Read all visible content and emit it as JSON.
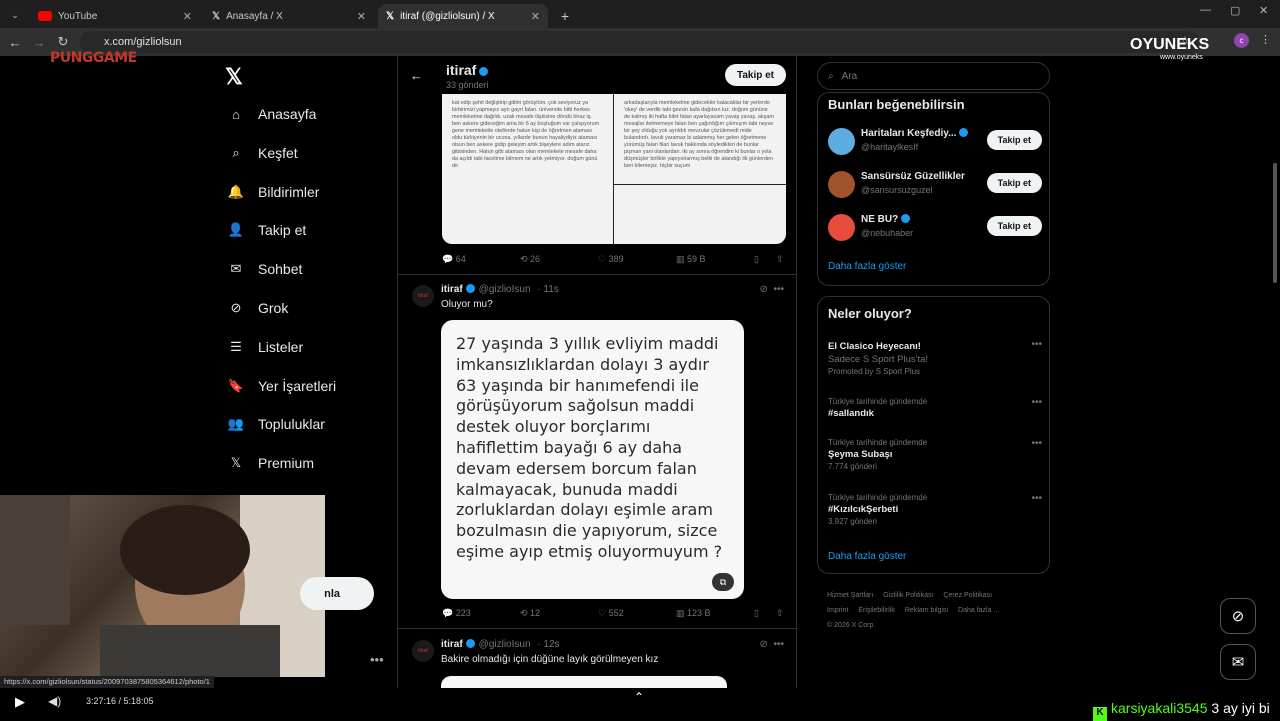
{
  "browser": {
    "tabs": [
      {
        "title": "YouTube",
        "active": false
      },
      {
        "title": "Anasayfa / X",
        "active": false
      },
      {
        "title": "itiraf (@gizliolsun) / X",
        "active": true
      }
    ],
    "url": "x.com/gizliolsun"
  },
  "overlays": {
    "channel_logo": "PUNGGAME",
    "brand": "OYUNEKS",
    "brand_sub": "www.oyuneks"
  },
  "nav": {
    "items": [
      "Anasayfa",
      "Keşfet",
      "Bildirimler",
      "Takip et",
      "Sohbet",
      "Grok",
      "Listeler",
      "Yer İşaretleri",
      "Topluluklar",
      "Premium"
    ],
    "post_button": "nla"
  },
  "profile": {
    "title": "itiraf",
    "subtitle": "33 gönderi",
    "follow_label": "Takip et"
  },
  "tweets": [
    {
      "image_text_left": "kat edip şehit değiştirip gittim görüştüm. çok seviyoruz ya birbirimizi yapmayız ayrı gayri falan. üniversite bitti herkes memleketine dağıldı. uzak mesafe ilişkisine döndü biraz iş. ben askere gideceğim ama bir 6 ay boştuğum var çalışıyorum gene memlekette otellerde hatun kişi de öğretmen ataması oldu türkiyenin bir ucuna. yıllardır bunun hayaliydiyiz ataması olsun ben askere gidip geleyim artık bişeylere adım atarız gibisinden. Hatun gitti ataması olan memlekete mesafe daha da açıldı tabi facetime bilmem ne artık yetmiyor. doğum günü de",
      "image_text_right": "arkadaşlarıyla memleketine gidecekler kalacaklar bir yerlerde 'okey' de verdik tabi gezsin kafa dağıtsın kız. doğum gününe de kalmış iki hafta bilet falan ayarlayacam yavaş yavaş. akşam mesajlar iletmemeye falan ben çağırdığım çıkmışım tabi neyse bir şey olduğu yok ayrıldık mevzular çözülemedi mide bulandırdı. lavuk yaramaz bi adammış her gelen öğretmene yürümüş falan filan lavuk hakkında söyledikleri de bunlar pişman yani olanlardan. iki ay sonra öğrendim ki bunlar o yola düşmüşler birlikte yapıyorlarmış belki de atandığı ilk günlerden beri bilemeyiz. hiçbir suçum",
      "stats": {
        "replies": "64",
        "retweets": "26",
        "likes": "389",
        "views": "59 B"
      }
    },
    {
      "name": "itiraf",
      "handle": "@gizlioIsun",
      "time": "· 11s",
      "text": "Oluyor mu?",
      "card_text": "27 yaşında 3 yıllık evliyim maddi imkansızlıklardan dolayı 3 aydır 63 yaşında bir hanımefendi ile görüşüyorum sağolsun maddi destek oluyor borçlarımı hafiflettim bayağı 6 ay daha devam edersem borcum falan kalmayacak, bunuda maddi zorluklardan dolayı eşimle aram bozulmasın die yapıyorum, sizce eşime ayıp etmiş oluyormuyum ?",
      "stats": {
        "replies": "223",
        "retweets": "12",
        "likes": "552",
        "views": "123 B"
      }
    },
    {
      "name": "itiraf",
      "handle": "@gizlioIsun",
      "time": "· 12s",
      "text": "Bakire olmadığı için düğüne layık görülmeyen kız"
    }
  ],
  "sidebar": {
    "search_placeholder": "Ara",
    "suggest_title": "Bunları beğenebilirsin",
    "suggestions": [
      {
        "name": "Haritaları Keşfediy...",
        "handle": "@haritaylkesIf",
        "button": "Takip et",
        "verified": true
      },
      {
        "name": "Sansürsüz Güzellikler",
        "handle": "@sansursuzguzel",
        "button": "Takip et",
        "verified": false
      },
      {
        "name": "NE BU?",
        "handle": "@nebuhaber",
        "button": "Takip et",
        "verified": true
      }
    ],
    "show_more": "Daha fazla göster",
    "trends_title": "Neler oluyor?",
    "trends": [
      {
        "context": "",
        "title": "El Clasico Heyecanı!",
        "sub": "Sadece S Sport Plus'ta!",
        "meta": "Promoted by S Sport Plus"
      },
      {
        "context": "Türkiye tarihinde gündemde",
        "title": "#sallandık",
        "meta": ""
      },
      {
        "context": "Türkiye tarihinde gündemde",
        "title": "Şeyma Subaşı",
        "meta": "7.774 gönderi"
      },
      {
        "context": "Türkiye tarihinde gündemde",
        "title": "#KızılcıkŞerbeti",
        "meta": "3.927 gönderi"
      }
    ],
    "show_more2": "Daha fazla göster",
    "footer": [
      "Hizmet Şartları",
      "Gizlilik Politikası",
      "Çerez Politikası",
      "Imprint",
      "Erişilebilirlik",
      "Reklam bilgisi",
      "Daha fazla ...",
      "© 2026 X Corp."
    ]
  },
  "status_url": "https://x.com/gizliolsun/status/2009703875805364612/photo/1",
  "player": {
    "time": "3:27:16 / 5:18:05"
  },
  "chat": {
    "user": "karsiyakali3545",
    "message": "3 ay iyi bi"
  },
  "colors": {
    "accent": "#1d9bf0",
    "background": "#000000",
    "kick_green": "#53fc18"
  }
}
